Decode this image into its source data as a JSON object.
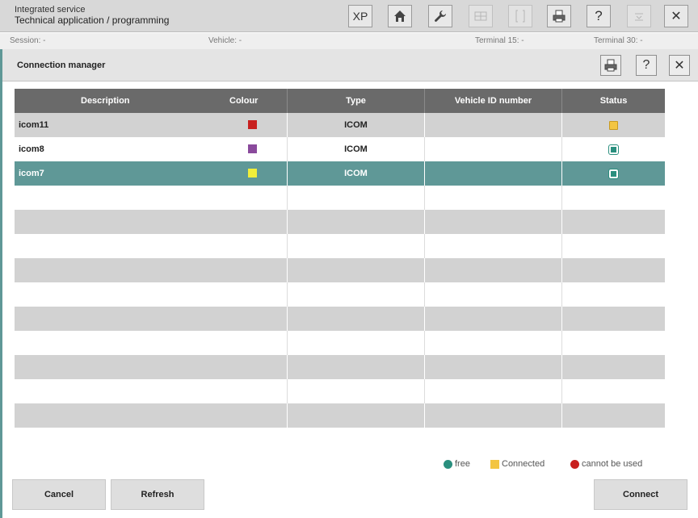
{
  "app": {
    "title_line1": "Integrated service",
    "title_line2": "Technical application / programming"
  },
  "toolbar": {
    "xp_label": "XP",
    "help_label": "?",
    "close_label": "✕",
    "icons": [
      "home-icon",
      "wrench-icon",
      "grid-icon",
      "bracket-icon",
      "print-icon",
      "help-icon",
      "minimize-icon",
      "close-icon"
    ]
  },
  "info": {
    "session": "Session:  -",
    "vehicle": "Vehicle:  -",
    "terminal15": "Terminal 15:  -",
    "terminal30": "Terminal 30:  -"
  },
  "dialog": {
    "title": "Connection manager",
    "help_label": "?",
    "close_label": "✕"
  },
  "table": {
    "headers": {
      "description": "Description",
      "colour": "Colour",
      "type": "Type",
      "vin": "Vehicle ID number",
      "status": "Status"
    },
    "rows": [
      {
        "description": "icom11",
        "colour": "#c8201f",
        "type": "ICOM",
        "vin": "",
        "status": "connected"
      },
      {
        "description": "icom8",
        "colour": "#8a4a9c",
        "type": "ICOM",
        "vin": "",
        "status": "free"
      },
      {
        "description": "icom7",
        "colour": "#f1ee3a",
        "type": "ICOM",
        "vin": "",
        "status": "free",
        "selected": true
      }
    ],
    "empty_rows": 10
  },
  "legend": {
    "free": "free",
    "connected": "Connected",
    "cannot_use": "cannot be used",
    "colors": {
      "free": "#2a8f7e",
      "connected": "#f3c542",
      "cannot_use": "#c8201f"
    }
  },
  "buttons": {
    "cancel": "Cancel",
    "refresh": "Refresh",
    "connect": "Connect"
  },
  "colors": {
    "accent": "#5f9897",
    "header_bg": "#6a6a6a"
  }
}
